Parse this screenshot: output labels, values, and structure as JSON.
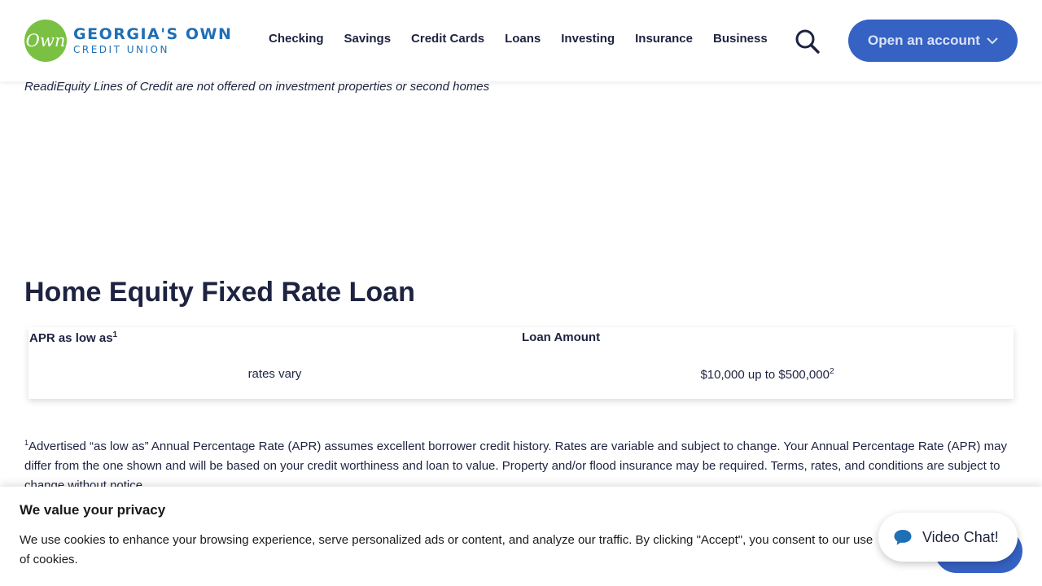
{
  "brand": {
    "logo_script": "Own",
    "name": "GEORGIA'S OWN",
    "subtitle": "CREDIT UNION",
    "colors": {
      "green": "#7ac143",
      "blue": "#1f6fb5",
      "button": "#3662c4"
    }
  },
  "nav": {
    "items": [
      {
        "label": "Checking"
      },
      {
        "label": "Savings"
      },
      {
        "label": "Credit Cards"
      },
      {
        "label": "Loans"
      },
      {
        "label": "Investing"
      },
      {
        "label": "Insurance"
      },
      {
        "label": "Business"
      }
    ],
    "search_icon": "search-icon",
    "open_account_label": "Open an account",
    "open_account_icon": "chevron-down-icon"
  },
  "content": {
    "note": "ReadiEquity Lines of Credit are not offered on investment properties or second homes",
    "section_title": "Home Equity Fixed Rate Loan",
    "table": {
      "col1_header": "APR as low as",
      "col1_header_sup": "1",
      "col1_value": "rates vary",
      "col2_header": "Loan Amount",
      "col2_value": "$10,000 up to $500,000",
      "col2_value_sup": "2"
    },
    "footnote_sup": "1",
    "footnote": "Advertised “as low as” Annual Percentage Rate (APR) assumes excellent borrower credit history. Rates are variable and subject to change. Your Annual Percentage Rate (APR) may differ from the one shown and will be based on your credit worthiness and loan to value. Property and/or flood insurance may be required. Terms, rates, and conditions are subject to change without notice."
  },
  "privacy": {
    "title": "We value your privacy",
    "text": "We use cookies to enhance your browsing experience, serve personalized ads or content, and analyze our traffic. By clicking \"Accept\", you consent to our use of cookies."
  },
  "chat": {
    "label": "Video Chat!",
    "icon": "chat-bubble-icon"
  }
}
